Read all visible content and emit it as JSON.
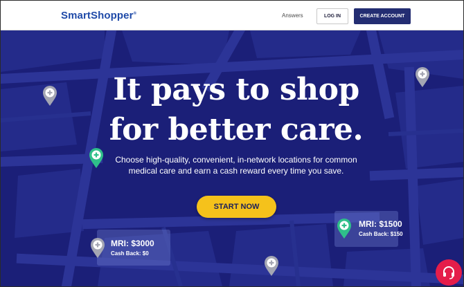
{
  "header": {
    "logo_text": "SmartShopper",
    "logo_mark": "®",
    "nav_answers": "Answers",
    "login_label": "LOG IN",
    "create_account_label": "CREATE ACCOUNT"
  },
  "hero": {
    "headline_line1": "It pays to shop",
    "headline_line2": "for better care.",
    "subtitle_line1": "Choose high-quality, convenient, in-network locations for common",
    "subtitle_line2": "medical care and earn a cash reward every time you save.",
    "cta_label": "START NOW",
    "background_color": "#1b1f78",
    "cta_color": "#f5c21b"
  },
  "price_cards": [
    {
      "title": "MRI: $3000",
      "cashback": "Cash Back: $0"
    },
    {
      "title": "MRI: $1500",
      "cashback": "Cash Back: $150"
    }
  ],
  "map_pins": [
    {
      "icon": "map-pin-icon",
      "color": "gray"
    },
    {
      "icon": "map-pin-icon",
      "color": "gray"
    },
    {
      "icon": "map-pin-icon",
      "color": "green"
    },
    {
      "icon": "map-pin-icon",
      "color": "gray"
    },
    {
      "icon": "map-pin-icon",
      "color": "green"
    },
    {
      "icon": "map-pin-icon",
      "color": "gray"
    }
  ],
  "help_widget": {
    "icon": "headset-icon",
    "color": "#e51d4a"
  }
}
